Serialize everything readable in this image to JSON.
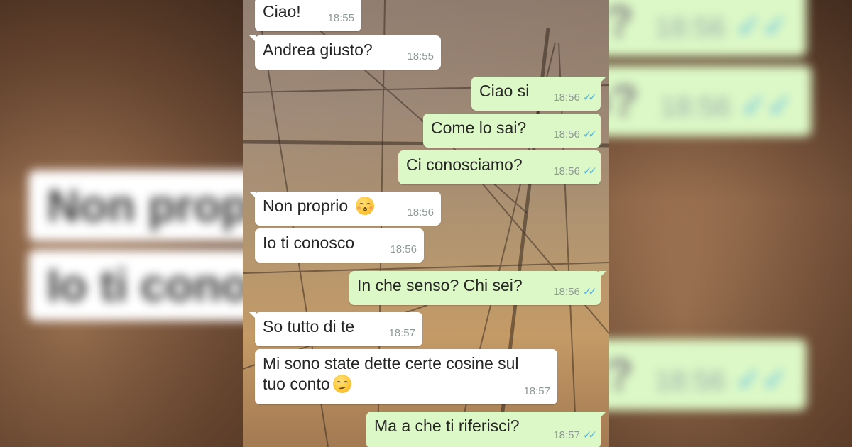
{
  "colors": {
    "incoming_bubble": "#ffffff",
    "outgoing_bubble": "#dcf8c6",
    "read_tick": "#4fb6ec",
    "timestamp": "#8f9a95"
  },
  "messages": [
    {
      "dir": "in",
      "text": "Ciao!",
      "time": "18:55",
      "emoji": null
    },
    {
      "dir": "in",
      "text": "Andrea giusto?",
      "time": "18:55",
      "emoji": null
    },
    {
      "dir": "out",
      "text": "Ciao si",
      "time": "18:56",
      "status": "read-double-check-icon"
    },
    {
      "dir": "out",
      "text": "Come lo sai?",
      "time": "18:56",
      "status": "read-double-check-icon"
    },
    {
      "dir": "out",
      "text": "Ci conosciamo?",
      "time": "18:56",
      "status": "read-double-check-icon"
    },
    {
      "dir": "in",
      "text": "Non proprio",
      "time": "18:56",
      "emoji": "kissing-closed-eyes-emoji"
    },
    {
      "dir": "in",
      "text": "Io ti conosco",
      "time": "18:56",
      "emoji": null
    },
    {
      "dir": "out",
      "text": "In che senso? Chi sei?",
      "time": "18:56",
      "status": "read-double-check-icon"
    },
    {
      "dir": "in",
      "text": "So tutto di te",
      "time": "18:57",
      "emoji": null
    },
    {
      "dir": "in",
      "text_line1": "Mi sono state dette certe cosine sul",
      "text_line2": "tuo conto",
      "time": "18:57",
      "emoji": "smirking-face-emoji"
    },
    {
      "dir": "out",
      "text": "Ma a che ti riferisci?",
      "time": "18:57",
      "status": "read-double-check-icon"
    }
  ]
}
